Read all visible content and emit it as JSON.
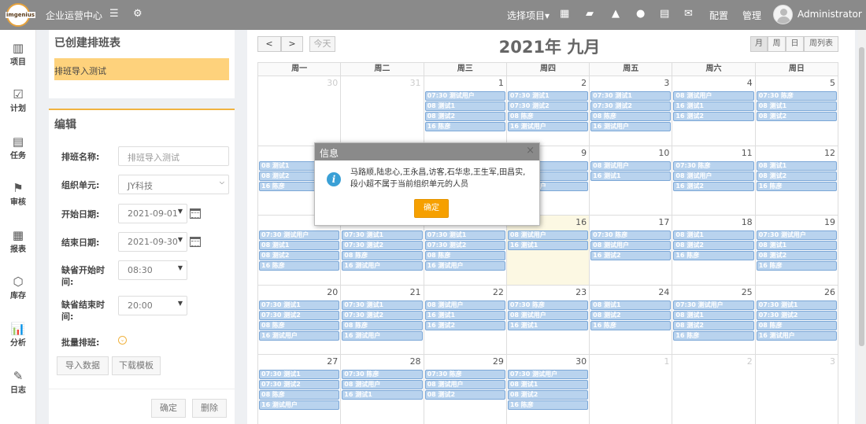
{
  "topbar": {
    "logo_text": "imgenius",
    "app_title": "企业运营中心",
    "project_select": "选择项目▾",
    "config": "配置",
    "manage": "管理",
    "user": "Administrator",
    "icons": [
      "menu-icon",
      "gear-icon",
      "grid-icon",
      "map-icon",
      "building-icon",
      "user-icon",
      "calendar-icon",
      "mail-icon"
    ]
  },
  "nav": {
    "items": [
      {
        "label": "项目",
        "icon": "▥"
      },
      {
        "label": "计划",
        "icon": "☑"
      },
      {
        "label": "任务",
        "icon": "▤"
      },
      {
        "label": "审核",
        "icon": "⚑"
      },
      {
        "label": "报表",
        "icon": "▦"
      },
      {
        "label": "库存",
        "icon": "⬡"
      },
      {
        "label": "分析",
        "icon": "📊"
      },
      {
        "label": "日志",
        "icon": "✎"
      }
    ]
  },
  "created": {
    "title": "已创建排班表",
    "item": "排班导入测试"
  },
  "edit": {
    "title": "编辑",
    "name_label": "排班名称:",
    "name_placeholder": "排班导入测试",
    "org_label": "组织单元:",
    "org_value": "JY科技",
    "start_label": "开始日期:",
    "start_value": "2021-09-01",
    "end_label": "结束日期:",
    "end_value": "2021-09-30",
    "def_start_label": "缺省开始时间:",
    "def_start_value": "08:30",
    "def_end_label": "缺省结束时间:",
    "def_end_value": "20:00",
    "batch_label": "批量排班:",
    "import_btn": "导入数据",
    "template_btn": "下载模板",
    "confirm_btn": "确定",
    "delete_btn": "删除"
  },
  "calendar": {
    "prev": "<",
    "next": ">",
    "today": "今天",
    "title": "2021年 九月",
    "views": [
      "月",
      "周",
      "日",
      "周列表"
    ],
    "weekdays": [
      "周一",
      "周二",
      "周三",
      "周四",
      "周五",
      "周六",
      "周日"
    ],
    "weeks": [
      [
        {
          "day": "30",
          "other": true,
          "events": []
        },
        {
          "day": "31",
          "other": true,
          "events": []
        },
        {
          "day": "1",
          "events": [
            "07:30 测试用户",
            "08 测试1",
            "08 测试2",
            "16 陈彦"
          ]
        },
        {
          "day": "2",
          "events": [
            "07:30 测试1",
            "07:30 测试2",
            "08 陈彦",
            "16 测试用户"
          ]
        },
        {
          "day": "3",
          "events": [
            "07:30 测试1",
            "07:30 测试2",
            "08 陈彦",
            "16 测试用户"
          ]
        },
        {
          "day": "4",
          "events": [
            "08 测试用户",
            "16 测试1",
            "16 测试2"
          ]
        },
        {
          "day": "5",
          "events": [
            "07:30 陈彦",
            "08 测试1",
            "08 测试2"
          ]
        }
      ],
      [
        {
          "day": "6",
          "events": [
            "08 测试1",
            "08 测试2",
            "16 陈彦"
          ]
        },
        {
          "day": "7",
          "events": []
        },
        {
          "day": "8",
          "events": []
        },
        {
          "day": "9",
          "events": [
            "08 测试1",
            "08 测试2",
            "16 测试用户"
          ]
        },
        {
          "day": "10",
          "events": [
            "08 测试用户",
            "16 测试1"
          ]
        },
        {
          "day": "11",
          "events": [
            "07:30 陈彦",
            "08 测试用户",
            "16 测试2"
          ]
        },
        {
          "day": "12",
          "events": [
            "08 测试1",
            "08 测试2",
            "16 陈彦"
          ]
        }
      ],
      [
        {
          "day": "13",
          "events": [
            "07:30 测试用户",
            "08 测试1",
            "08 测试2",
            "16 陈彦"
          ]
        },
        {
          "day": "14",
          "events": [
            "07:30 测试1",
            "07:30 测试2",
            "08 陈彦",
            "16 测试用户"
          ]
        },
        {
          "day": "15",
          "events": [
            "07:30 测试1",
            "07:30 测试2",
            "08 陈彦",
            "16 测试用户"
          ]
        },
        {
          "day": "16",
          "today": true,
          "events": [
            "08 测试用户",
            "16 测试1"
          ]
        },
        {
          "day": "17",
          "events": [
            "07:30 陈彦",
            "08 测试用户",
            "16 测试2"
          ]
        },
        {
          "day": "18",
          "events": [
            "08 测试1",
            "08 测试2",
            "16 陈彦"
          ]
        },
        {
          "day": "19",
          "events": [
            "07:30 测试用户",
            "08 测试1",
            "08 测试2",
            "16 陈彦"
          ]
        }
      ],
      [
        {
          "day": "20",
          "events": [
            "07:30 测试1",
            "07:30 测试2",
            "08 陈彦",
            "16 测试用户"
          ]
        },
        {
          "day": "21",
          "events": [
            "07:30 测试1",
            "07:30 测试2",
            "08 陈彦",
            "16 测试用户"
          ]
        },
        {
          "day": "22",
          "events": [
            "08 测试用户",
            "16 测试1",
            "16 测试2"
          ]
        },
        {
          "day": "23",
          "events": [
            "07:30 陈彦",
            "08 测试用户",
            "16 测试1"
          ]
        },
        {
          "day": "24",
          "events": [
            "08 测试1",
            "08 测试2",
            "16 陈彦"
          ]
        },
        {
          "day": "25",
          "events": [
            "07:30 测试用户",
            "08 测试1",
            "08 测试2",
            "16 陈彦"
          ]
        },
        {
          "day": "26",
          "events": [
            "07:30 测试1",
            "07:30 测试2",
            "08 陈彦",
            "16 测试用户"
          ]
        }
      ],
      [
        {
          "day": "27",
          "events": [
            "07:30 测试1",
            "07:30 测试2",
            "08 陈彦",
            "16 测试用户"
          ]
        },
        {
          "day": "28",
          "events": [
            "07:30 陈彦",
            "08 测试用户",
            "16 测试1"
          ]
        },
        {
          "day": "29",
          "events": [
            "07:30 陈彦",
            "08 测试用户",
            "08 测试2"
          ]
        },
        {
          "day": "30",
          "events": [
            "07:30 测试用户",
            "08 测试1",
            "08 测试2",
            "16 陈彦"
          ]
        },
        {
          "day": "1",
          "other": true,
          "events": []
        },
        {
          "day": "2",
          "other": true,
          "events": []
        },
        {
          "day": "3",
          "other": true,
          "events": []
        }
      ]
    ]
  },
  "modal": {
    "title": "信息",
    "close": "×",
    "message": "马路顺,陆忠心,王永昌,访客,石华忠,王生军,田昌实,段小超不属于当前组织单元的人员",
    "ok": "确定"
  },
  "colors": {
    "topbar": "#8a8a8a",
    "accent": "#f6a000",
    "selected_item": "#fed27c",
    "event": "#b9d3ee"
  }
}
